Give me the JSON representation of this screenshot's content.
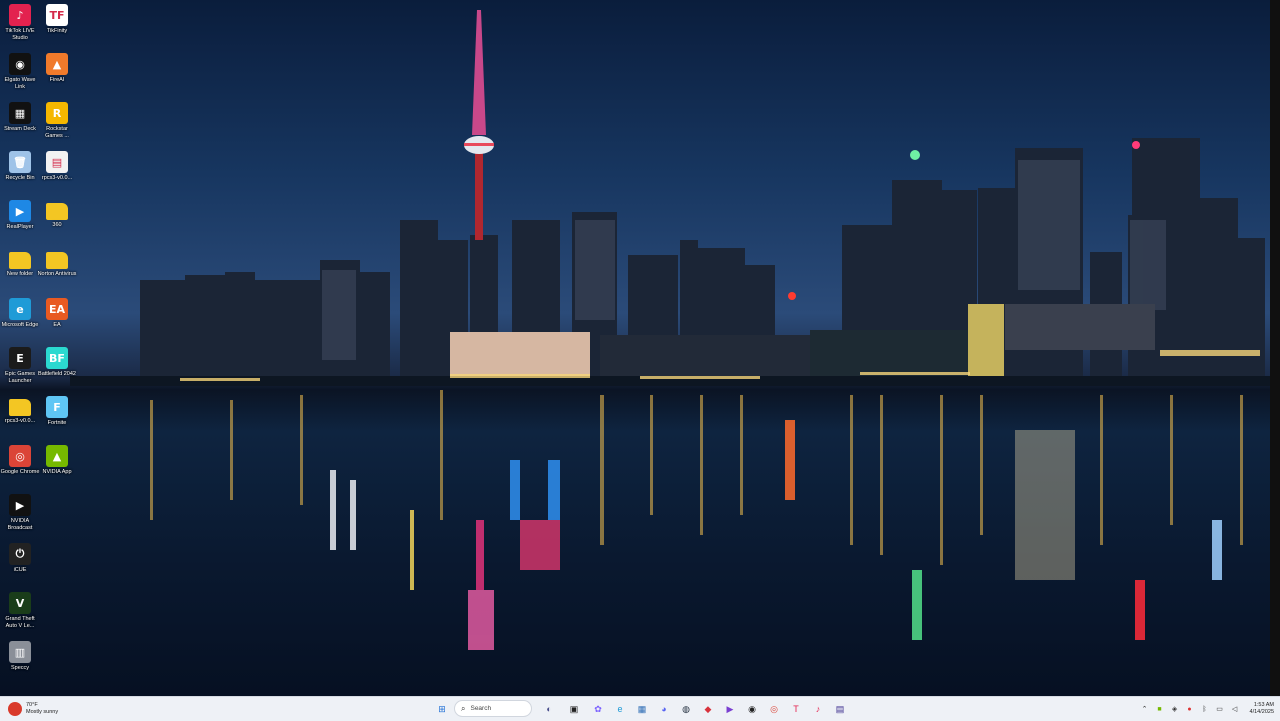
{
  "desktop": {
    "icons": [
      {
        "label": "TikTok LIVE Studio",
        "glyph": "♪",
        "color": "#e3224f",
        "icon": "tiktok-icon"
      },
      {
        "label": "TikFinity",
        "glyph": "TF",
        "color": "#ffffff",
        "icon": "tikfinity-icon"
      },
      {
        "label": "Elgato Wave Link",
        "glyph": "◉",
        "color": "#111111",
        "icon": "wave-link-icon"
      },
      {
        "label": "FireAI",
        "glyph": "▲",
        "color": "#f07a2b",
        "icon": "fireai-icon"
      },
      {
        "label": "Stream Deck",
        "glyph": "▦",
        "color": "#111111",
        "icon": "stream-deck-icon"
      },
      {
        "label": "Rockstar Games ...",
        "glyph": "R",
        "color": "#f5b700",
        "icon": "rockstar-icon"
      },
      {
        "label": "Recycle Bin",
        "glyph": "🗑",
        "color": "#9fc3e8",
        "icon": "recycle-bin-icon"
      },
      {
        "label": "rpcs3-v0.0...",
        "glyph": "▤",
        "color": "#f2f2f2",
        "icon": "document-icon"
      },
      {
        "label": "RealPlayer",
        "glyph": "▶",
        "color": "#1e88e5",
        "icon": "realplayer-icon"
      },
      {
        "label": "360",
        "glyph": "",
        "color": "#f3c623",
        "icon": "folder-icon"
      },
      {
        "label": "New folder",
        "glyph": "",
        "color": "#f3c623",
        "icon": "folder-icon"
      },
      {
        "label": "Norton Antivirus",
        "glyph": "",
        "color": "#f3c623",
        "icon": "folder-icon"
      },
      {
        "label": "Microsoft Edge",
        "glyph": "e",
        "color": "#1f9bd7",
        "icon": "edge-icon"
      },
      {
        "label": "EA",
        "glyph": "EA",
        "color": "#e85a22",
        "icon": "ea-icon"
      },
      {
        "label": "Epic Games Launcher",
        "glyph": "E",
        "color": "#1b1b1b",
        "icon": "epic-games-icon"
      },
      {
        "label": "Battlefield 2042",
        "glyph": "BF",
        "color": "#2bd9d0",
        "icon": "battlefield-icon"
      },
      {
        "label": "rpcs3-v0.0...",
        "glyph": "",
        "color": "#f3c623",
        "icon": "folder-icon"
      },
      {
        "label": "Fortnite",
        "glyph": "F",
        "color": "#5fc6f5",
        "icon": "fortnite-icon"
      },
      {
        "label": "Google Chrome",
        "glyph": "◎",
        "color": "#db4437",
        "icon": "chrome-icon"
      },
      {
        "label": "NVIDIA App",
        "glyph": "▲",
        "color": "#76b900",
        "icon": "nvidia-icon"
      },
      {
        "label": "NVIDIA Broadcast",
        "glyph": "▶",
        "color": "#111111",
        "icon": "nvidia-broadcast-icon"
      },
      {
        "label": "iCUE",
        "glyph": "⏻",
        "color": "#222222",
        "icon": "icue-icon"
      },
      {
        "label": "Grand Theft Auto V Le...",
        "glyph": "V",
        "color": "#1a3d1a",
        "icon": "gta-icon"
      },
      {
        "label": "Speccy",
        "glyph": "▥",
        "color": "#8a8f98",
        "icon": "speccy-icon"
      }
    ]
  },
  "taskbar": {
    "weather_temp": "70°F",
    "weather_desc": "Mostly sunny",
    "search_placeholder": "Search",
    "apps": [
      {
        "icon": "windows-start-icon",
        "glyph": "⊞",
        "color": "#1f6fd6"
      },
      {
        "icon": "gamepad-icon",
        "glyph": "◐",
        "color": "#4a4f8c"
      },
      {
        "icon": "task-view-icon",
        "glyph": "▣",
        "color": "#222222"
      },
      {
        "icon": "copilot-icon",
        "glyph": "✿",
        "color": "#7b61ff"
      },
      {
        "icon": "edge-icon",
        "glyph": "e",
        "color": "#1f9bd7"
      },
      {
        "icon": "store-icon",
        "glyph": "▦",
        "color": "#2d6cb5"
      },
      {
        "icon": "discord-icon",
        "glyph": "◕",
        "color": "#5865f2"
      },
      {
        "icon": "steam-icon",
        "glyph": "◍",
        "color": "#1b2838"
      },
      {
        "icon": "app-red-icon",
        "glyph": "◆",
        "color": "#d8323c"
      },
      {
        "icon": "media-icon",
        "glyph": "▶",
        "color": "#7a3fd1"
      },
      {
        "icon": "obs-icon",
        "glyph": "◉",
        "color": "#222222"
      },
      {
        "icon": "chrome-icon",
        "glyph": "◎",
        "color": "#db4437"
      },
      {
        "icon": "tikfinity-icon",
        "glyph": "T",
        "color": "#e3224f"
      },
      {
        "icon": "tiktok-icon",
        "glyph": "♪",
        "color": "#e3224f"
      },
      {
        "icon": "terminal-icon",
        "glyph": "▤",
        "color": "#3a2a8c"
      }
    ],
    "clock_time": "1:53 AM",
    "clock_date": "4/14/2025"
  }
}
